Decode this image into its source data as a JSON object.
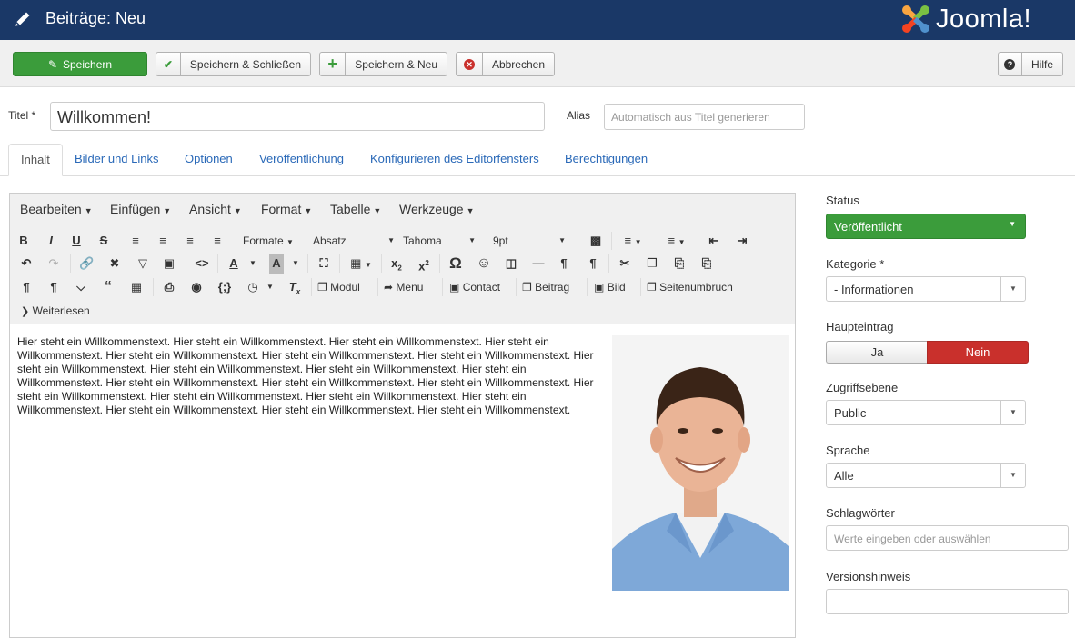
{
  "header": {
    "title": "Beiträge: Neu",
    "logo_text": "Joomla!"
  },
  "toolbar": {
    "save": "Speichern",
    "save_close": "Speichern & Schließen",
    "save_new": "Speichern & Neu",
    "cancel": "Abbrechen",
    "help": "Hilfe"
  },
  "form": {
    "title_label": "Titel *",
    "title_value": "Willkommen!",
    "alias_label": "Alias",
    "alias_placeholder": "Automatisch aus Titel generieren"
  },
  "tabs": [
    "Inhalt",
    "Bilder und Links",
    "Optionen",
    "Veröffentlichung",
    "Konfigurieren des Editorfensters",
    "Berechtigungen"
  ],
  "editor": {
    "menus": [
      "Bearbeiten",
      "Einfügen",
      "Ansicht",
      "Format",
      "Tabelle",
      "Werkzeuge"
    ],
    "formats": "Formate",
    "block": "Absatz",
    "font": "Tahoma",
    "size": "9pt",
    "buttons": {
      "modul": "Modul",
      "menu": "Menu",
      "contact": "Contact",
      "article": "Beitrag",
      "image": "Bild",
      "pagebreak": "Seitenumbruch",
      "readmore": "Weiterlesen"
    },
    "content": "Hier steht ein Willkommenstext. Hier steht ein Willkommenstext. Hier steht ein Willkommenstext. Hier steht ein Willkommenstext. Hier steht ein Willkommenstext. Hier steht ein Willkommenstext. Hier steht ein Willkommenstext. Hier steht ein Willkommenstext. Hier steht ein Willkommenstext. Hier steht ein Willkommenstext. Hier steht ein Willkommenstext. Hier steht ein Willkommenstext. Hier steht ein Willkommenstext. Hier steht ein Willkommenstext. Hier steht ein Willkommenstext. Hier steht ein Willkommenstext. Hier steht ein Willkommenstext. Hier steht ein Willkommenstext. Hier steht ein Willkommenstext. Hier steht ein Willkommenstext. Hier steht ein Willkommenstext."
  },
  "sidebar": {
    "status_label": "Status",
    "status_value": "Veröffentlicht",
    "category_label": "Kategorie *",
    "category_value": "- Informationen",
    "featured_label": "Haupteintrag",
    "featured_yes": "Ja",
    "featured_no": "Nein",
    "access_label": "Zugriffsebene",
    "access_value": "Public",
    "language_label": "Sprache",
    "language_value": "Alle",
    "tags_label": "Schlagwörter",
    "tags_placeholder": "Werte eingeben oder auswählen",
    "version_label": "Versionshinweis",
    "version_value": ""
  },
  "colors": {
    "header": "#1a3867",
    "success": "#3b9c3b",
    "danger": "#c9302c",
    "link": "#2a69b8"
  }
}
